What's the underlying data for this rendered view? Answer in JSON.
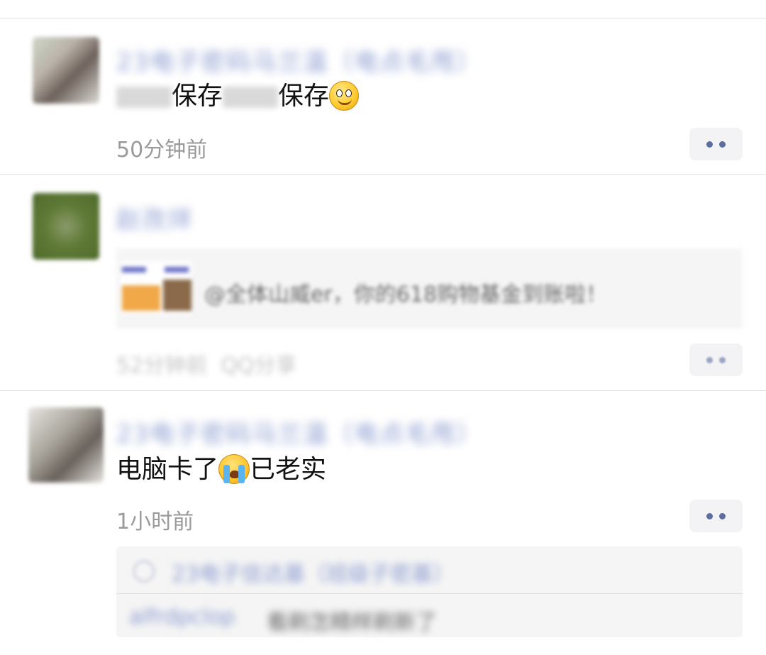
{
  "posts": [
    {
      "name": "23电子密码马兰温（电点毛甩）",
      "message_a": "保存",
      "message_b": "保存",
      "emoji": "smile-emoji",
      "time": "50分钟前"
    },
    {
      "name": "赵孜烊",
      "share_text": "@全体山威er，你的618购物基金到账啦！",
      "time": "52分钟前",
      "source": "QQ分享"
    },
    {
      "name": "23电子密码马兰温（电点毛甩）",
      "message_a": "电脑卡了",
      "emoji": "crying-emoji",
      "message_b": "已老实",
      "time": "1小时前",
      "reply": {
        "liker": "23电子信达基（班级子密基）",
        "user": "alfrdpclop",
        "text": "看刷怎精样刷新了"
      }
    }
  ],
  "colors": {
    "name": "#8a9bd0",
    "dot": "#5b6e9e",
    "time": "#9a9a9a"
  }
}
